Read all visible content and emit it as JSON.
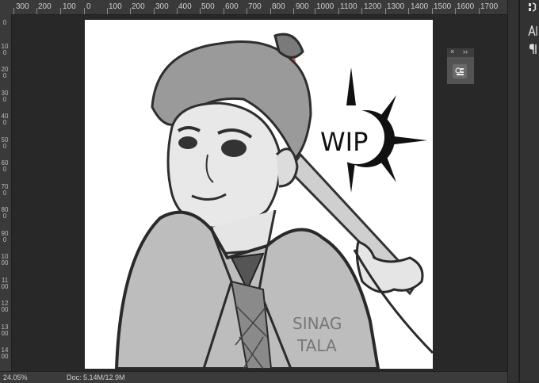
{
  "ruler": {
    "top_labels": [
      "300",
      "200",
      "100",
      "0",
      "100",
      "200",
      "300",
      "400",
      "500",
      "600",
      "700",
      "800",
      "900",
      "1000",
      "1100",
      "1200",
      "1300",
      "1400",
      "1500",
      "1600",
      "1700"
    ],
    "left_labels": [
      "0",
      "100",
      "200",
      "300",
      "400",
      "500",
      "600",
      "700",
      "800",
      "900",
      "1000",
      "1100",
      "1200",
      "1300",
      "1400"
    ]
  },
  "artwork": {
    "badge_text": "WIP",
    "signature_line1": "SINAG",
    "signature_line2": "TALA"
  },
  "panel": {
    "close_glyph": "×",
    "expand_glyph": "››",
    "button_icon": "layer-comps-icon"
  },
  "dock": {
    "icon1": "character-icon",
    "icon2": "paragraph-icon"
  },
  "status": {
    "zoom": "24.05%",
    "doc": "Doc: 5.14M/12.9M"
  }
}
